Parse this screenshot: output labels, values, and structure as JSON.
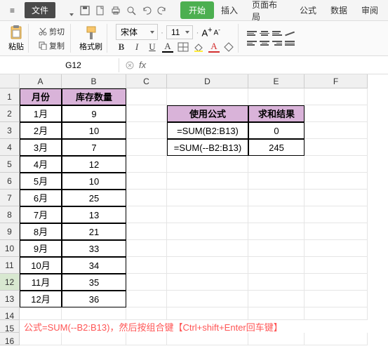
{
  "menu": {
    "hamburger": "≡",
    "file": "文件",
    "tabs": [
      "开始",
      "插入",
      "页面布局",
      "公式",
      "数据",
      "审阅"
    ],
    "active_tab": "开始"
  },
  "ribbon": {
    "paste": "粘贴",
    "cut": "剪切",
    "copy": "复制",
    "format_painter": "格式刷",
    "font_name": "宋体",
    "font_size": "11",
    "bold": "B",
    "italic": "I",
    "underline": "U",
    "font_big": "A",
    "font_small": "A"
  },
  "formula_bar": {
    "cell_ref": "G12",
    "fx": "fx",
    "formula": ""
  },
  "columns": [
    "A",
    "B",
    "C",
    "D",
    "E",
    "F"
  ],
  "row_numbers": [
    "1",
    "2",
    "3",
    "4",
    "5",
    "6",
    "7",
    "8",
    "9",
    "10",
    "11",
    "12",
    "13",
    "14",
    "15",
    "16"
  ],
  "table_main": {
    "header_month": "月份",
    "header_qty": "库存数量",
    "rows": [
      {
        "m": "1月",
        "q": "9"
      },
      {
        "m": "2月",
        "q": "10"
      },
      {
        "m": "3月",
        "q": "7"
      },
      {
        "m": "4月",
        "q": "12"
      },
      {
        "m": "5月",
        "q": "10"
      },
      {
        "m": "6月",
        "q": "25"
      },
      {
        "m": "7月",
        "q": "13"
      },
      {
        "m": "8月",
        "q": "21"
      },
      {
        "m": "9月",
        "q": "33"
      },
      {
        "m": "10月",
        "q": "34"
      },
      {
        "m": "11月",
        "q": "35"
      },
      {
        "m": "12月",
        "q": "36"
      }
    ]
  },
  "table_side": {
    "header_formula": "使用公式",
    "header_result": "求和结果",
    "rows": [
      {
        "f": "=SUM(B2:B13)",
        "r": "0"
      },
      {
        "f": "=SUM(--B2:B13)",
        "r": "245"
      }
    ]
  },
  "footer_note": "公式=SUM(--B2:B13)，然后按组合键【Ctrl+shift+Enter回车键】"
}
